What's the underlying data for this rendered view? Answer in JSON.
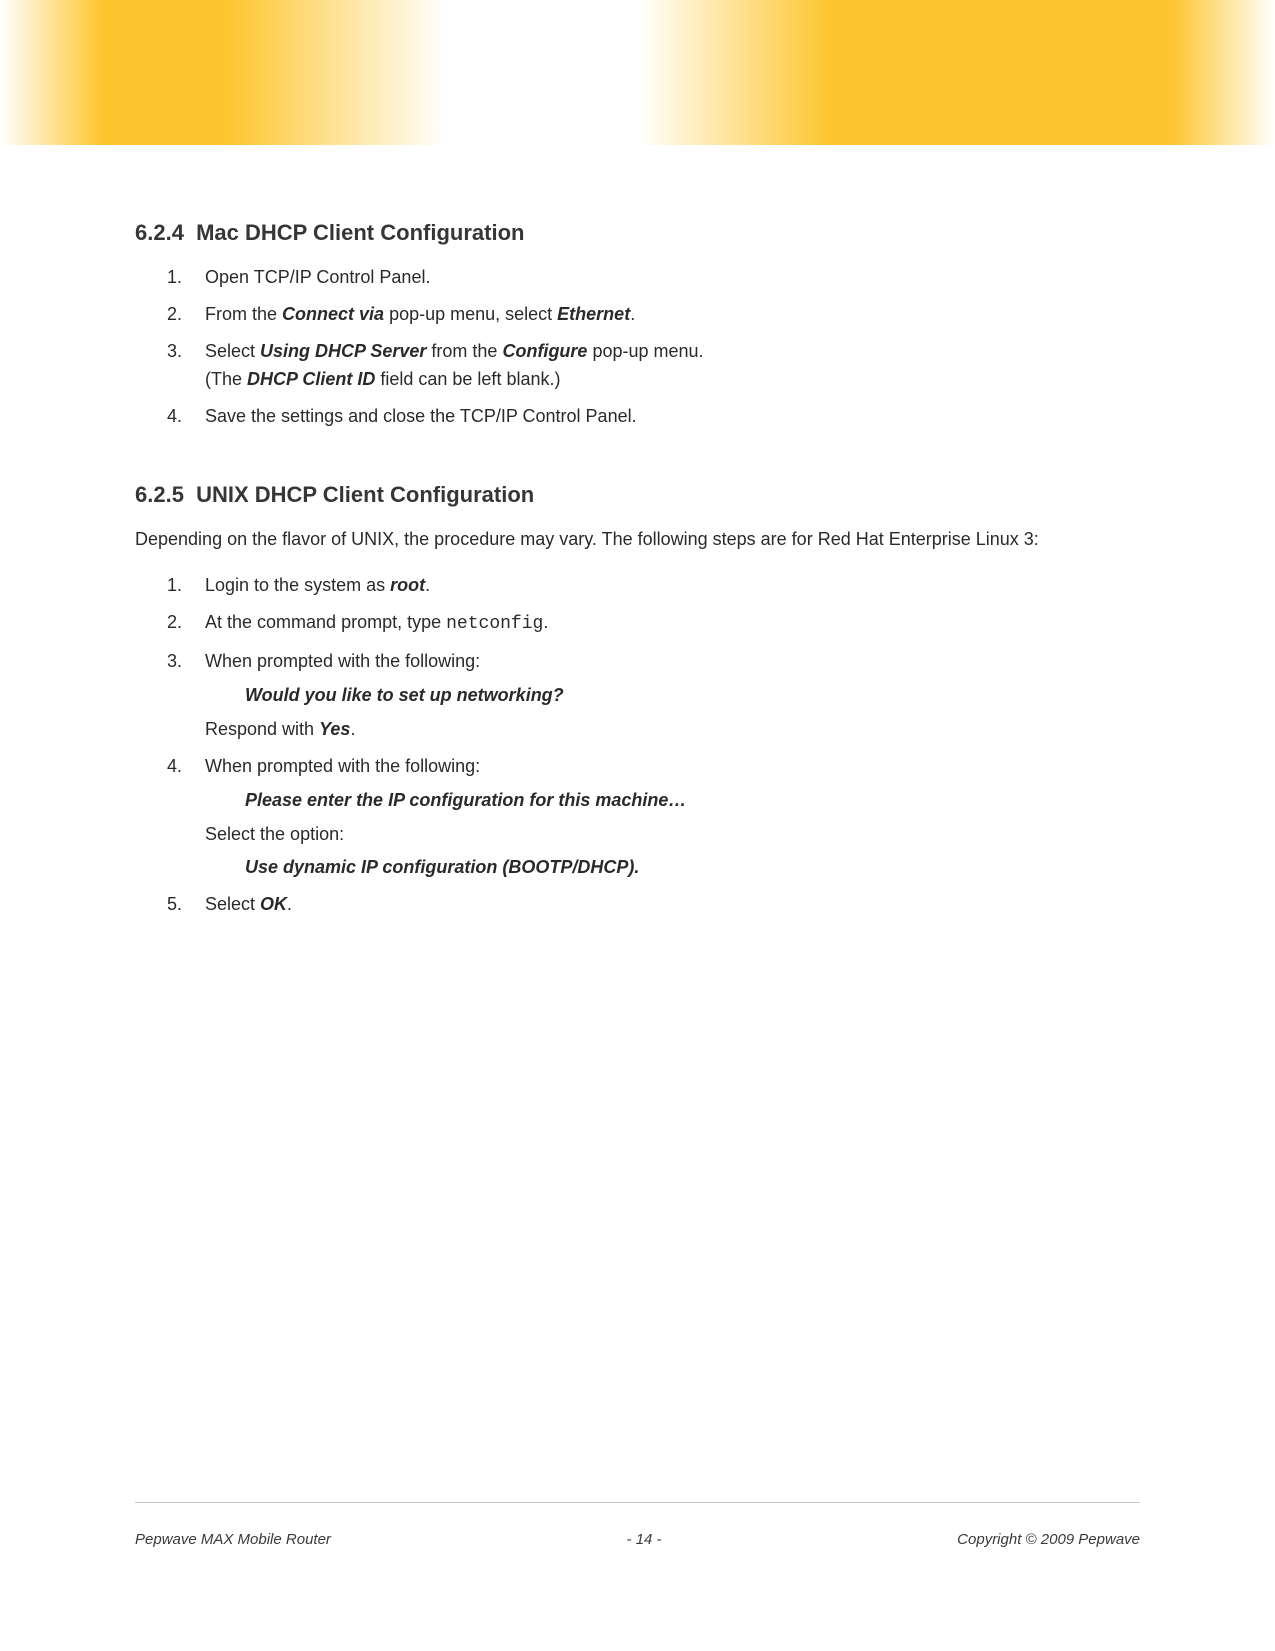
{
  "section624": {
    "number": "6.2.4",
    "title": "Mac DHCP Client Configuration",
    "steps": [
      {
        "text": "Open TCP/IP Control Panel."
      },
      {
        "prefix": "From the ",
        "bold1": "Connect via",
        "mid": " pop-up menu, select ",
        "bold2": "Ethernet",
        "suffix": "."
      },
      {
        "prefix": "Select ",
        "bold1": "Using DHCP Server",
        "mid": " from the ",
        "bold2": "Configure",
        "suffix": " pop-up menu.",
        "linebreak": true,
        "line2_prefix": "(The ",
        "line2_bold": "DHCP Client ID",
        "line2_suffix": " field can be left blank.)"
      },
      {
        "text": "Save the settings and close the TCP/IP Control Panel."
      }
    ]
  },
  "section625": {
    "number": "6.2.5",
    "title": "UNIX DHCP Client Configuration",
    "intro": "Depending on the flavor of UNIX, the procedure may vary.  The following steps are for Red Hat Enterprise Linux 3:",
    "step1_prefix": "Login to the system as ",
    "step1_bold": "root",
    "step1_suffix": ".",
    "step2_prefix": "At the command prompt, type ",
    "step2_mono": "netconfig",
    "step2_suffix": ".",
    "step3_line1": "When prompted with the following:",
    "step3_prompt": "Would you like to set up networking?",
    "step3_respond_prefix": "Respond with ",
    "step3_respond_bold": "Yes",
    "step3_respond_suffix": ".",
    "step4_line1": "When prompted with the following:",
    "step4_prompt": "Please enter the IP configuration for this machine…",
    "step4_select": "Select the option:",
    "step4_option": "Use dynamic IP configuration (BOOTP/DHCP).",
    "step5_prefix": "Select ",
    "step5_bold": "OK",
    "step5_suffix": "."
  },
  "footer": {
    "left": "Pepwave MAX Mobile Router",
    "center": "- 14 -",
    "right": "Copyright © 2009 Pepwave"
  }
}
